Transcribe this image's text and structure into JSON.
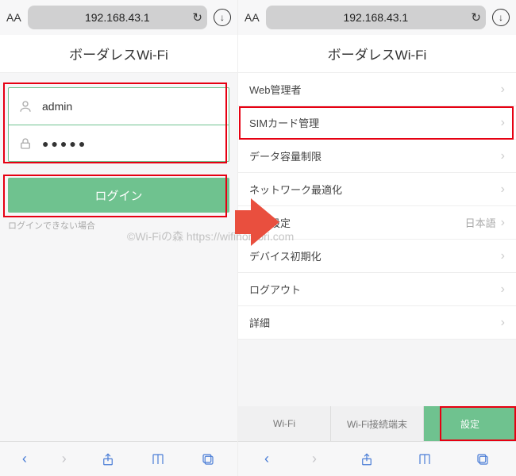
{
  "left": {
    "topbar": {
      "aa": "AA",
      "url": "192.168.43.1"
    },
    "title": "ボーダレスWi-Fi",
    "login": {
      "username": "admin",
      "password": "●●●●●",
      "button": "ログイン",
      "help": "ログインできない場合"
    }
  },
  "right": {
    "topbar": {
      "aa": "AA",
      "url": "192.168.43.1"
    },
    "title": "ボーダレスWi-Fi",
    "items": {
      "0": {
        "label": "Web管理者"
      },
      "1": {
        "label": "SIMカード管理"
      },
      "2": {
        "label": "データ容量制限"
      },
      "3": {
        "label": "ネットワーク最適化"
      },
      "4": {
        "label": "言語設定",
        "value": "日本語"
      },
      "5": {
        "label": "デバイス初期化"
      },
      "6": {
        "label": "ログアウト"
      },
      "7": {
        "label": "詳細"
      }
    },
    "tabs": {
      "0": "Wi-Fi",
      "1": "Wi-Fi接続端末",
      "2": "設定"
    }
  },
  "watermark": "©Wi-Fiの森 https://wifinomori.com"
}
